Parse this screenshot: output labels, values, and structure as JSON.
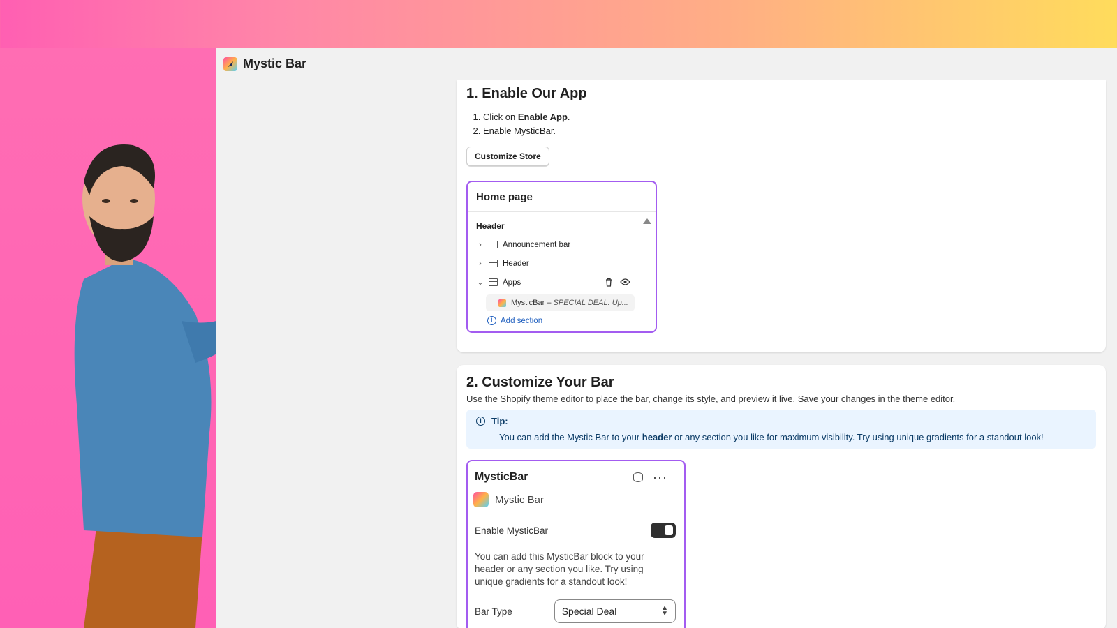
{
  "app": {
    "title": "Mystic Bar"
  },
  "section1": {
    "heading": "1. Enable Our App",
    "step1_prefix": "Click on ",
    "step1_bold": "Enable App",
    "step1_suffix": ".",
    "step2": "Enable MysticBar.",
    "button": "Customize Store",
    "panel": {
      "title": "Home page",
      "section_label": "Header",
      "rows": [
        {
          "label": "Announcement bar",
          "chevron": "›"
        },
        {
          "label": "Header",
          "chevron": "›"
        },
        {
          "label": "Apps",
          "chevron": "⌄"
        }
      ],
      "sub_item_name": "MysticBar – ",
      "sub_item_italic": "SPECIAL DEAL: Up...",
      "add_section": "Add section"
    }
  },
  "section2": {
    "heading": "2. Customize Your Bar",
    "description": "Use the Shopify theme editor to place the bar, change its style, and preview it live. Save your changes in the theme editor.",
    "tip": {
      "title": "Tip:",
      "body_prefix": "You can add the Mystic Bar to your ",
      "body_bold": "header",
      "body_suffix": " or any section you like for maximum visibility. Try using unique gradients for a standout look!"
    },
    "panel": {
      "title": "MysticBar",
      "brand": "Mystic Bar",
      "toggle_label": "Enable MysticBar",
      "toggle_on": true,
      "description": "You can add this MysticBar block to your header or any section you like. Try using unique gradients for a standout look!",
      "bar_type_label": "Bar Type",
      "bar_type_value": "Special Deal"
    }
  },
  "colors": {
    "accent": "#a35cf0",
    "link": "#1f5fbf",
    "tip_bg": "#eaf4ff"
  }
}
